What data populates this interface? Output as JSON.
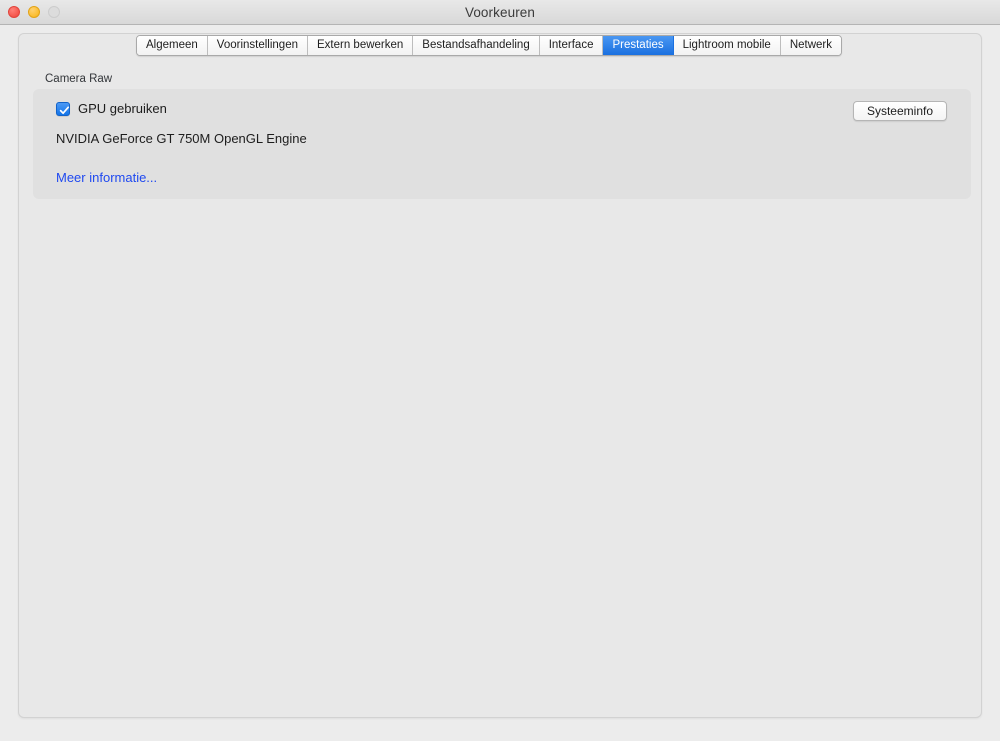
{
  "window": {
    "title": "Voorkeuren",
    "traffic_lights": [
      {
        "name": "close",
        "color": "#f5564c"
      },
      {
        "name": "minimize",
        "color": "#fbbd2e"
      },
      {
        "name": "zoom",
        "color": "#dcdcdc"
      }
    ]
  },
  "tabs": [
    {
      "label": "Algemeen",
      "selected": false
    },
    {
      "label": "Voorinstellingen",
      "selected": false
    },
    {
      "label": "Extern bewerken",
      "selected": false
    },
    {
      "label": "Bestandsafhandeling",
      "selected": false
    },
    {
      "label": "Interface",
      "selected": false
    },
    {
      "label": "Prestaties",
      "selected": true
    },
    {
      "label": "Lightroom mobile",
      "selected": false
    },
    {
      "label": "Netwerk",
      "selected": false
    }
  ],
  "selected_tab_color": "#1a70e0",
  "panel": {
    "group_label": "Camera Raw",
    "gpu_checkbox": {
      "label": "GPU gebruiken",
      "checked": true,
      "accent_color": "#1374e8"
    },
    "gpu_info": "NVIDIA GeForce GT 750M OpenGL Engine",
    "more_info_link": "Meer informatie...",
    "link_color": "#1f49f0",
    "system_info_button": "Systeeminfo"
  }
}
